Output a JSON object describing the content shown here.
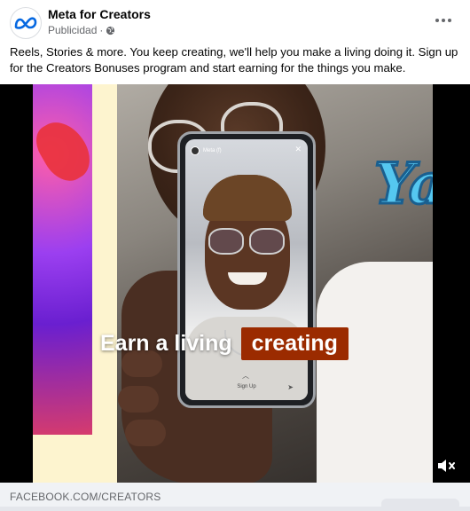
{
  "post": {
    "page_name": "Meta for Creators",
    "sponsored_label": "Publicidad",
    "separator": "·",
    "caption": "Reels, Stories & more. You keep creating, we'll help you make a living doing it. Sign up for the Creators Bonuses program and start earning for the things you make."
  },
  "media": {
    "overlay_text_1": "Earn a living",
    "overlay_text_2": "creating",
    "script_word": "Ya",
    "phone": {
      "story_user": "Meta (f)",
      "close_glyph": "✕",
      "signup_label": "Sign Up",
      "arrow_glyph": "︿",
      "share_glyph": "➤"
    }
  },
  "link": {
    "domain": "FACEBOOK.COM/CREATORS"
  },
  "colors": {
    "brand": "#0668E1",
    "overlay_badge": "#9b2b00",
    "script_fill": "#55c7f0"
  },
  "icons": {
    "logo": "meta-logo-icon",
    "globe": "globe-icon",
    "more": "more-options-icon",
    "mute": "muted-speaker-icon"
  }
}
